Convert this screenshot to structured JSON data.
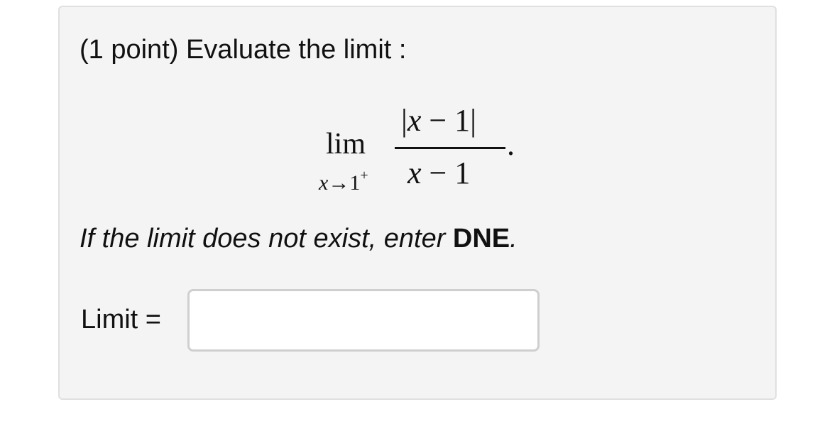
{
  "problem": {
    "intro": "(1 point) Evaluate the limit :",
    "expression": {
      "lim": "lim",
      "subscript_var": "x",
      "subscript_arrow": "→",
      "subscript_value": "1",
      "subscript_sup": "+",
      "numerator_left_bar": "|",
      "numerator_var": "x",
      "numerator_rest": " − 1",
      "numerator_right_bar": "|",
      "denominator_var": "x",
      "denominator_rest": " − 1",
      "period": "."
    },
    "instruction_prefix": "If the limit does not exist, enter ",
    "instruction_keyword": "DNE",
    "instruction_suffix": ".",
    "answer_label": "Limit =",
    "answer_value": ""
  },
  "colors": {
    "panel_background": "#f4f4f4",
    "panel_border": "#e0e0e0",
    "input_border": "#cfcfcf",
    "text": "#111111"
  }
}
